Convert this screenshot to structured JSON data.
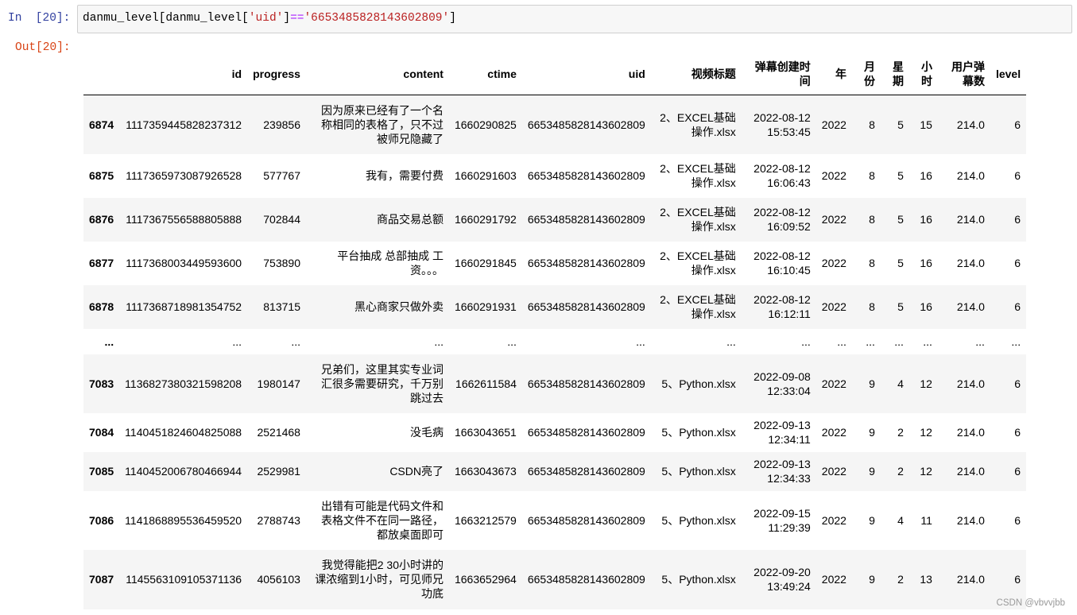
{
  "cell": {
    "in_prompt": "In  [20]:",
    "out_prompt": "Out[20]:",
    "code": {
      "part1": "danmu_level[danmu_level[",
      "str1": "'uid'",
      "part2": "]",
      "op": "==",
      "str2": "'6653485828143602809'",
      "part3": "]"
    }
  },
  "table": {
    "columns": [
      "id",
      "progress",
      "content",
      "ctime",
      "uid",
      "视频标题",
      "弹幕创建时间",
      "年",
      "月份",
      "星期",
      "小时",
      "用户弹幕数",
      "level"
    ],
    "rows": [
      {
        "index": "6874",
        "cells": [
          "1117359445828237312",
          "239856",
          "因为原来已经有了一个名称相同的表格了，只不过被师兄隐藏了",
          "1660290825",
          "6653485828143602809",
          "2、EXCEL基础操作.xlsx",
          "2022-08-12 15:53:45",
          "2022",
          "8",
          "5",
          "15",
          "214.0",
          "6"
        ]
      },
      {
        "index": "6875",
        "cells": [
          "1117365973087926528",
          "577767",
          "我有，需要付费",
          "1660291603",
          "6653485828143602809",
          "2、EXCEL基础操作.xlsx",
          "2022-08-12 16:06:43",
          "2022",
          "8",
          "5",
          "16",
          "214.0",
          "6"
        ]
      },
      {
        "index": "6876",
        "cells": [
          "1117367556588805888",
          "702844",
          "商品交易总额",
          "1660291792",
          "6653485828143602809",
          "2、EXCEL基础操作.xlsx",
          "2022-08-12 16:09:52",
          "2022",
          "8",
          "5",
          "16",
          "214.0",
          "6"
        ]
      },
      {
        "index": "6877",
        "cells": [
          "1117368003449593600",
          "753890",
          "平台抽成 总部抽成 工资。。。",
          "1660291845",
          "6653485828143602809",
          "2、EXCEL基础操作.xlsx",
          "2022-08-12 16:10:45",
          "2022",
          "8",
          "5",
          "16",
          "214.0",
          "6"
        ]
      },
      {
        "index": "6878",
        "cells": [
          "1117368718981354752",
          "813715",
          "黑心商家只做外卖",
          "1660291931",
          "6653485828143602809",
          "2、EXCEL基础操作.xlsx",
          "2022-08-12 16:12:11",
          "2022",
          "8",
          "5",
          "16",
          "214.0",
          "6"
        ]
      },
      {
        "index": "...",
        "cells": [
          "...",
          "...",
          "...",
          "...",
          "...",
          "...",
          "...",
          "...",
          "...",
          "...",
          "...",
          "...",
          "..."
        ]
      },
      {
        "index": "7083",
        "cells": [
          "1136827380321598208",
          "1980147",
          "兄弟们，这里其实专业词汇很多需要研究，千万别跳过去",
          "1662611584",
          "6653485828143602809",
          "5、Python.xlsx",
          "2022-09-08 12:33:04",
          "2022",
          "9",
          "4",
          "12",
          "214.0",
          "6"
        ]
      },
      {
        "index": "7084",
        "cells": [
          "1140451824604825088",
          "2521468",
          "没毛病",
          "1663043651",
          "6653485828143602809",
          "5、Python.xlsx",
          "2022-09-13 12:34:11",
          "2022",
          "9",
          "2",
          "12",
          "214.0",
          "6"
        ]
      },
      {
        "index": "7085",
        "cells": [
          "1140452006780466944",
          "2529981",
          "CSDN亮了",
          "1663043673",
          "6653485828143602809",
          "5、Python.xlsx",
          "2022-09-13 12:34:33",
          "2022",
          "9",
          "2",
          "12",
          "214.0",
          "6"
        ]
      },
      {
        "index": "7086",
        "cells": [
          "1141868895536459520",
          "2788743",
          "出错有可能是代码文件和表格文件不在同一路径，都放桌面即可",
          "1663212579",
          "6653485828143602809",
          "5、Python.xlsx",
          "2022-09-15 11:29:39",
          "2022",
          "9",
          "4",
          "11",
          "214.0",
          "6"
        ]
      },
      {
        "index": "7087",
        "cells": [
          "1145563109105371136",
          "4056103",
          "我觉得能把2 30小时讲的课浓缩到1小时，可见师兄功底",
          "1663652964",
          "6653485828143602809",
          "5、Python.xlsx",
          "2022-09-20 13:49:24",
          "2022",
          "9",
          "2",
          "13",
          "214.0",
          "6"
        ]
      }
    ]
  },
  "watermark": "CSDN @vbvvjbb"
}
